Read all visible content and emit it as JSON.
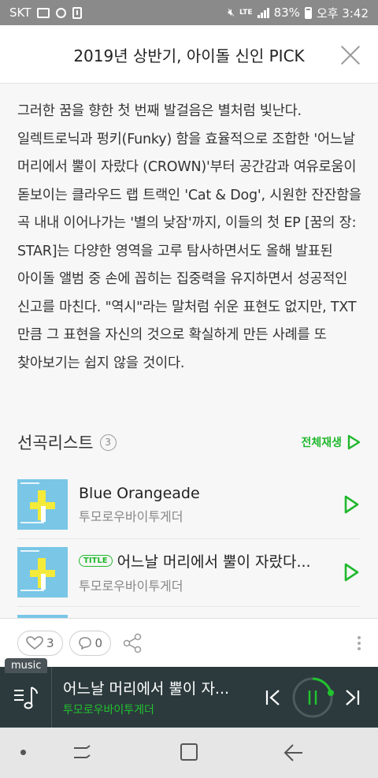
{
  "status_bar": {
    "carrier": "SKT",
    "network": "LTE",
    "battery": "83%",
    "time": "오후 3:42"
  },
  "header": {
    "title": "2019년 상반기, 아이돌 신인 PICK",
    "close_icon": "close-icon"
  },
  "description": "그러한 꿈을 향한 첫 번째 발걸음은 별처럼 빛난다. 일렉트로닉과 펑키(Funky) 함을 효율적으로 조합한 '어느날 머리에서 뿔이 자랐다 (CROWN)'부터 공간감과 여유로움이 돋보이는 클라우드 랩 트랙인 'Cat & Dog', 시원한 잔잔함을 곡 내내 이어나가는 '별의 낮잠'까지, 이들의 첫 EP [꿈의 장: STAR]는 다양한 영역을 고루 탐사하면서도 올해 발표된 아이돌 앨범 중 손에 꼽히는 집중력을 유지하면서 성공적인 신고를 마친다. \"역시\"라는 말처럼 쉬운 표현도 없지만, TXT 만큼 그 표현을 자신의 것으로 확실하게 만든 사례를 또 찾아보기는 쉽지 않을 것이다.",
  "tracklist": {
    "title": "선곡리스트",
    "count": "3",
    "play_all_label": "전체재생",
    "tracks": [
      {
        "name": "Blue Orangeade",
        "artist": "투모로우바이투게더",
        "badge": ""
      },
      {
        "name": "어느날 머리에서 뿔이 자랐다...",
        "artist": "투모로우바이투게더",
        "badge": "TITLE"
      }
    ]
  },
  "actions": {
    "likes": "3",
    "comments": "0"
  },
  "player": {
    "tag": "music",
    "title": "어느날 머리에서 뿔이 자...",
    "artist": "투모로우바이투게더",
    "accent": "#21c32e"
  },
  "colors": {
    "accent_green": "#21b82d",
    "player_bg": "#2c3a3d",
    "status_bar_bg": "#8a8a8a"
  }
}
